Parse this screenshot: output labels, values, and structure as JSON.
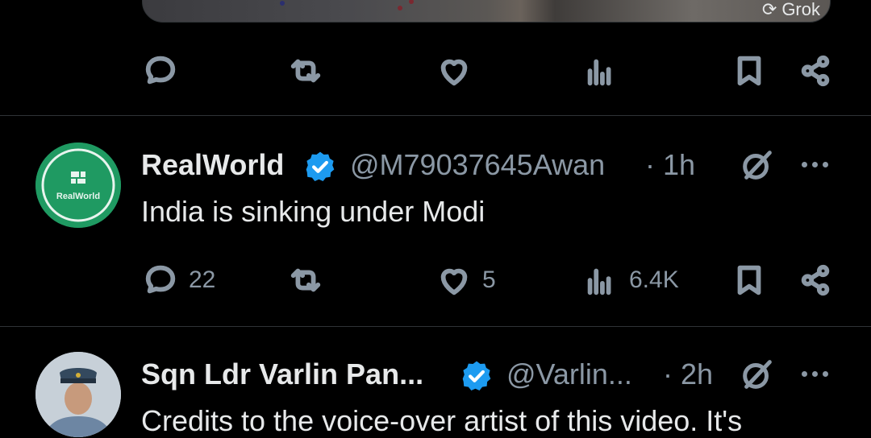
{
  "media": {
    "badge_label": "Grok"
  },
  "tweets": [
    {
      "name": "RealWorld",
      "handle": "@M79037645Awan",
      "time": "· 1h",
      "text": "India is sinking under Modi",
      "avatar_label": "RealWorld",
      "stats": {
        "replies": "22",
        "retweets": "",
        "likes": "5",
        "views": "6.4K"
      }
    },
    {
      "name": "Sqn Ldr Varlin Pan...",
      "handle": "@Varlin...",
      "time": "· 2h",
      "text": "Credits to the voice-over artist of this video. It's"
    }
  ],
  "colors": {
    "background": "#000000",
    "text": "#e7e9ea",
    "muted": "#8b98a5",
    "verified": "#1d9bf0",
    "divider": "#2f3336"
  }
}
